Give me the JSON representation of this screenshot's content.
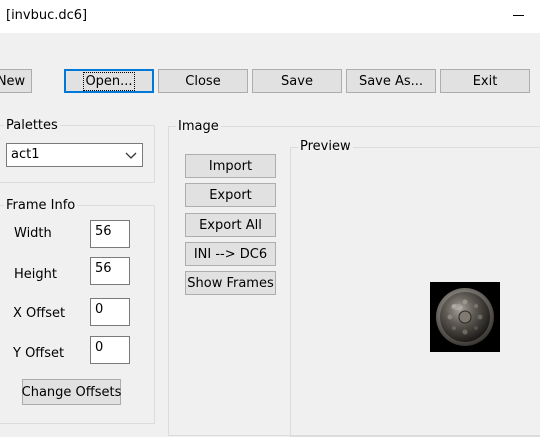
{
  "window": {
    "title": "[invbuc.dc6]"
  },
  "toolbar": {
    "new_label": "New",
    "open_label": "Open...",
    "close_label": "Close",
    "save_label": "Save",
    "save_as_label": "Save As...",
    "exit_label": "Exit"
  },
  "palettes": {
    "group_label": "Palettes",
    "selected": "act1"
  },
  "frame_info": {
    "group_label": "Frame Info",
    "width_label": "Width",
    "width_value": "56",
    "height_label": "Height",
    "height_value": "56",
    "x_offset_label": "X Offset",
    "x_offset_value": "0",
    "y_offset_label": "Y Offset",
    "y_offset_value": "0",
    "change_offsets_label": "Change Offsets"
  },
  "image": {
    "group_label": "Image",
    "import_label": "Import",
    "export_label": "Export",
    "export_all_label": "Export All",
    "ini_dc6_label": "INI --> DC6",
    "show_frames_label": "Show Frames"
  },
  "preview": {
    "group_label": "Preview"
  },
  "icons": {
    "minimize": "minimize-icon",
    "dropdown": "chevron-down-icon",
    "preview": "round-shield-icon"
  }
}
